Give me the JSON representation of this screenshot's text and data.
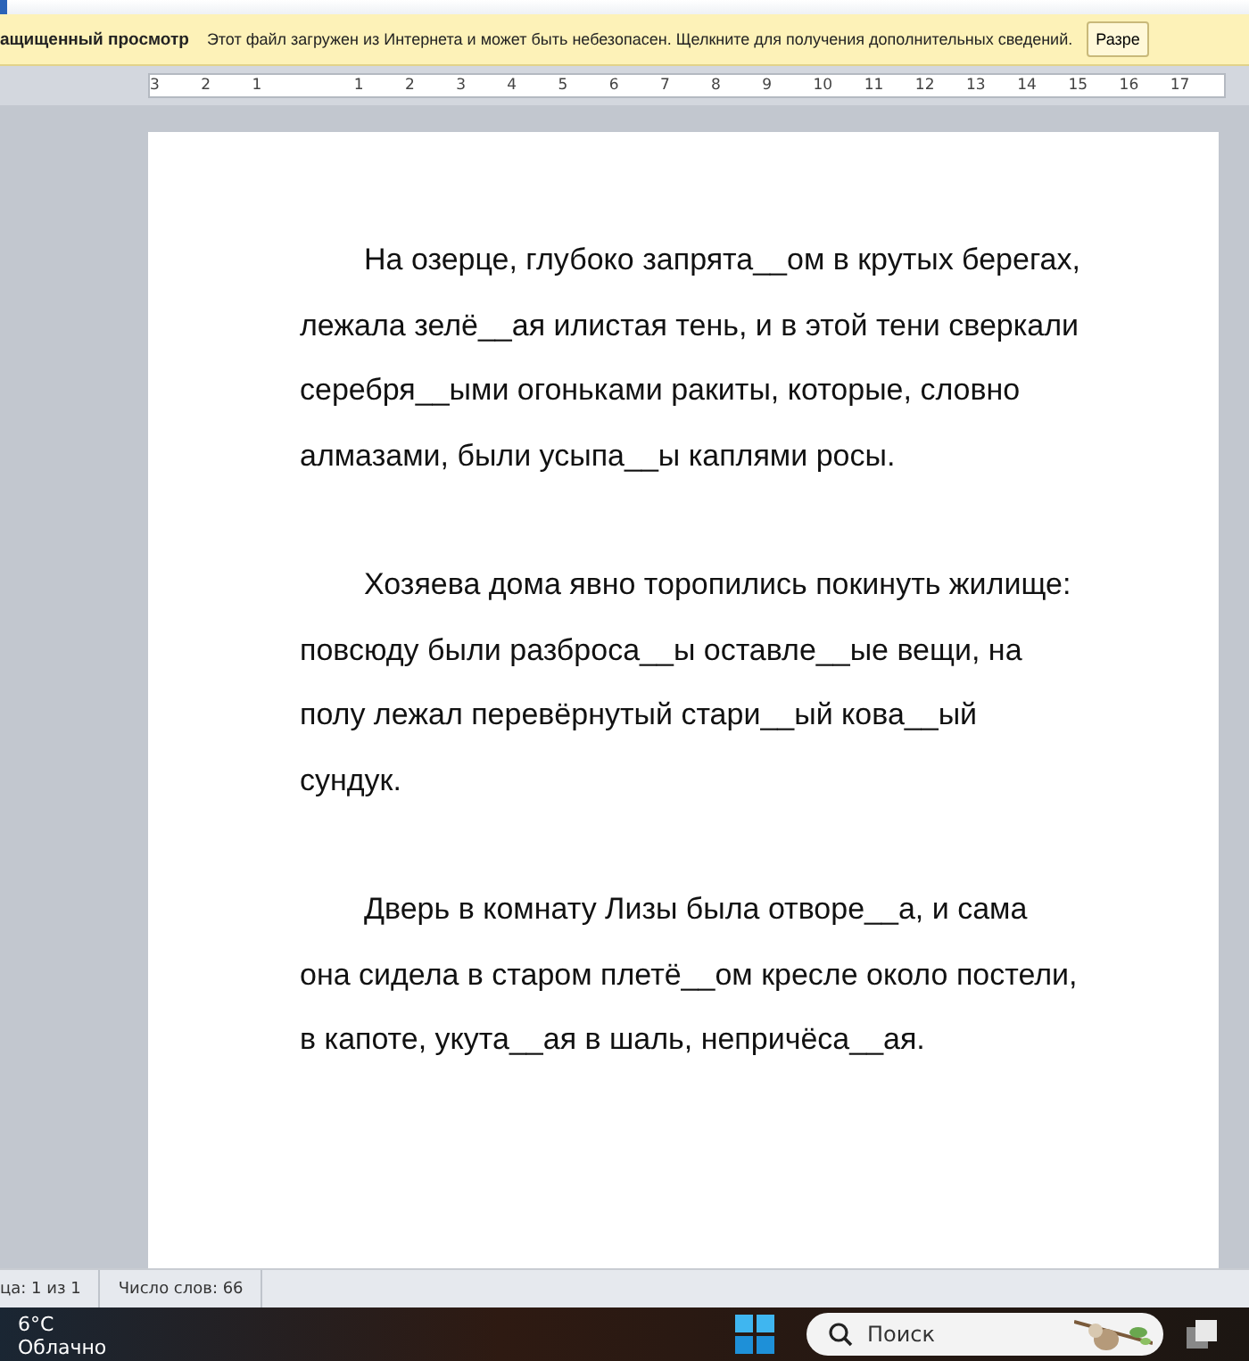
{
  "message_bar": {
    "title": "ащищенный просмотр",
    "text": "Этот файл загружен из Интернета и может быть небезопасен. Щелкните для получения дополнительных сведений.",
    "button": "Разре"
  },
  "ruler": {
    "left_labels": [
      "3",
      "2",
      "1"
    ],
    "right_labels": [
      "1",
      "2",
      "3",
      "4",
      "5",
      "6",
      "7",
      "8",
      "9",
      "10",
      "11",
      "12",
      "13",
      "14",
      "15",
      "16",
      "17"
    ]
  },
  "document": {
    "paragraphs": [
      {
        "lines": [
          "На озерце, глубоко запрята__ом в крутых берегах,",
          "лежала зелё__ая илистая тень, и в этой тени сверкали",
          "серебря__ыми огоньками ракиты, которые, словно",
          "алмазами, были усыпа__ы каплями росы."
        ]
      },
      {
        "lines": [
          "Хозяева дома явно торопились покинуть жилище:",
          "повсюду были разброса__ы оставле__ые вещи, на",
          "полу лежал перевёрнутый стари__ый кова__ый",
          "сундук."
        ]
      },
      {
        "lines": [
          "Дверь в комнату Лизы была отворе__а, и сама",
          "она сидела в старом плетё__ом кресле около постели,",
          "в капоте, укута__ая в шаль, непричёса__ая."
        ]
      }
    ]
  },
  "status_bar": [
    "ца: 1 из 1",
    "Число слов: 66"
  ],
  "taskbar": {
    "temperature": "6°C",
    "weather": "Облачно",
    "search_placeholder": "Поиск"
  }
}
